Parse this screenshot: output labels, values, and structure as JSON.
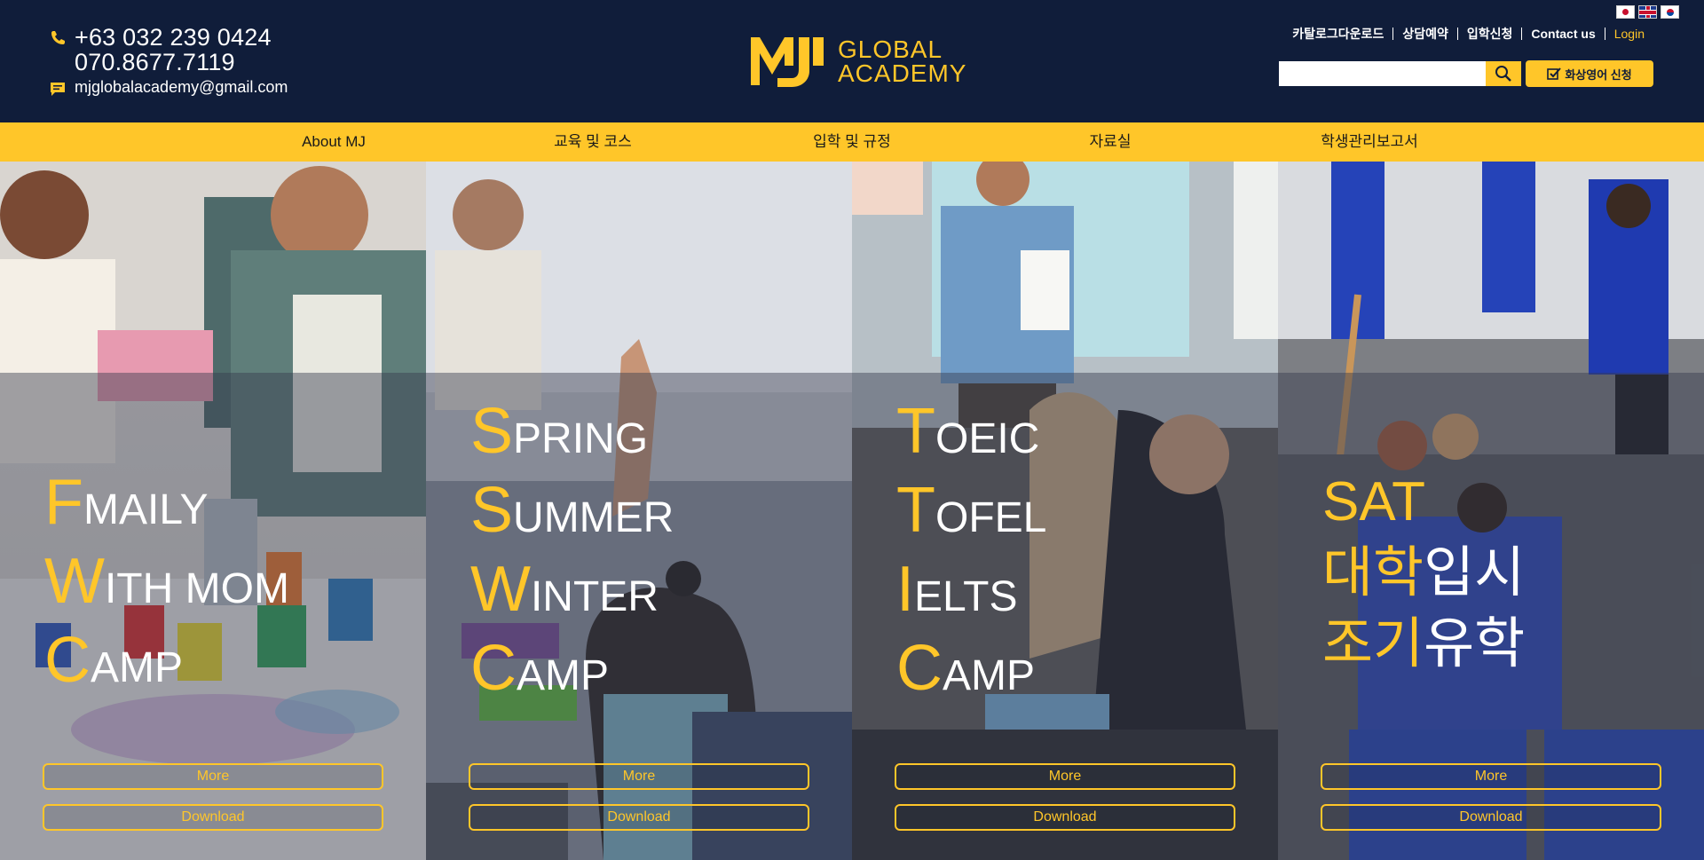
{
  "header": {
    "phone1": "+63 032 239 0424",
    "phone2": "070.8677.7119",
    "email": "mjglobalacademy@gmail.com",
    "logo_line1": "GLOBAL",
    "logo_line2": "ACADEMY",
    "links": [
      "카탈로그다운로드",
      "상담예약",
      "입학신청",
      "Contact us",
      "Login"
    ],
    "search_placeholder": "",
    "apply_label": "화상영어 신청",
    "accent_color": "#ffc629",
    "bg_color": "#101d3a"
  },
  "nav": {
    "items": [
      "About MJ",
      "교육 및 코스",
      "입학 및 규정",
      "자료실",
      "학생관리보고서"
    ]
  },
  "panels": [
    {
      "lines": [
        {
          "first": "F",
          "rest": "MAILY"
        },
        {
          "first": "W",
          "rest": "ITH MOM"
        },
        {
          "first": "C",
          "rest": "AMP"
        }
      ],
      "more": "More",
      "download": "Download"
    },
    {
      "lines": [
        {
          "first": "S",
          "rest": "PRING"
        },
        {
          "first": "S",
          "rest": "UMMER"
        },
        {
          "first": "W",
          "rest": "INTER"
        },
        {
          "first": "C",
          "rest": "AMP"
        }
      ],
      "more": "More",
      "download": "Download"
    },
    {
      "lines": [
        {
          "first": "T",
          "rest": "OEIC"
        },
        {
          "first": "T",
          "rest": "OFEL"
        },
        {
          "first": "I",
          "rest": "ELTS"
        },
        {
          "first": "C",
          "rest": "AMP"
        }
      ],
      "more": "More",
      "download": "Download"
    },
    {
      "lines": [
        {
          "first": "SAT",
          "rest": ""
        },
        {
          "first": "대학",
          "rest": "입시"
        },
        {
          "first": "조기",
          "rest": "유학"
        }
      ],
      "more": "More",
      "download": "Download"
    }
  ]
}
